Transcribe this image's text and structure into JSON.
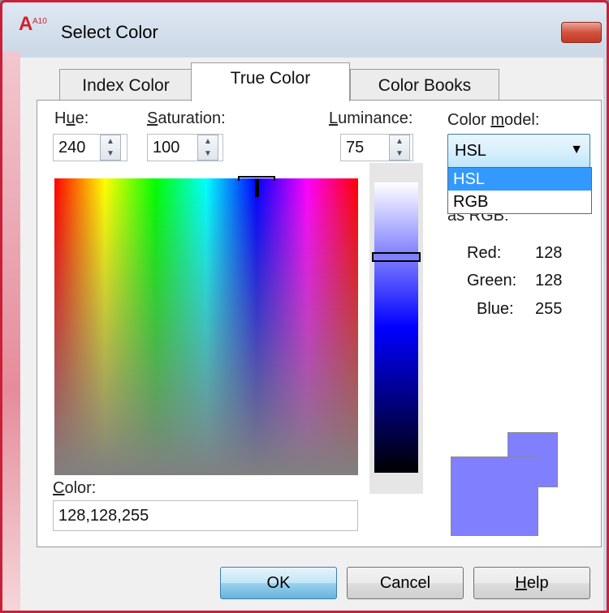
{
  "window": {
    "title": "Select Color",
    "app_icon_text": "A10",
    "close_symbol": "✕"
  },
  "tabs": [
    {
      "label": "Index Color",
      "active": false
    },
    {
      "label": "True Color",
      "active": true
    },
    {
      "label": "Color Books",
      "active": false
    }
  ],
  "hue": {
    "label_pre": "H",
    "label_u": "u",
    "label_post": "e:",
    "value": "240"
  },
  "saturation": {
    "label_u": "S",
    "label_post": "aturation:",
    "value": "100"
  },
  "luminance": {
    "label_u": "L",
    "label_post": "uminance:",
    "value": "75"
  },
  "color_model": {
    "label_pre": "Color ",
    "label_u": "m",
    "label_post": "odel:",
    "selected": "HSL",
    "options": [
      "HSL",
      "RGB"
    ],
    "highlighted": "HSL"
  },
  "as_rgb_label": "as RGB:",
  "rgb": {
    "red_label": "Red:",
    "red": "128",
    "green_label": "Green:",
    "green": "128",
    "blue_label": "Blue:",
    "blue": "255"
  },
  "color_field": {
    "label_u": "C",
    "label_post": "olor:",
    "value": "128,128,255"
  },
  "buttons": {
    "ok": "OK",
    "cancel": "Cancel",
    "help_u": "H",
    "help_post": "elp"
  },
  "colors": {
    "current": "#8080ff",
    "border": "#c91f37"
  },
  "icons": {
    "spin_up": "▲",
    "spin_down": "▼",
    "dropdown": "▼"
  }
}
